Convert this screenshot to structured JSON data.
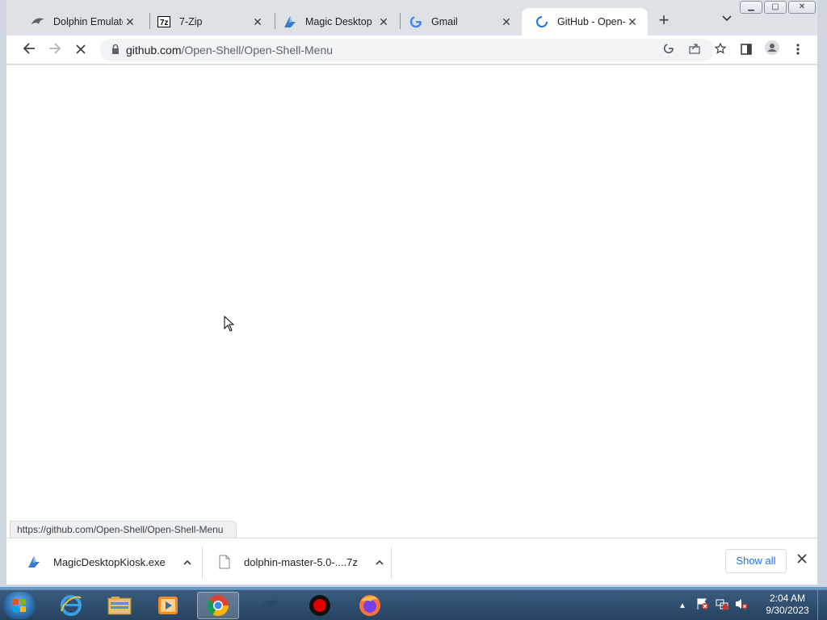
{
  "browser": {
    "tabs": [
      {
        "title": "Dolphin Emulator",
        "icon": "dolphin-icon"
      },
      {
        "title": "7-Zip",
        "icon": "7zip-icon"
      },
      {
        "title": "Magic Desktop",
        "icon": "magic-desktop-icon"
      },
      {
        "title": "Gmail",
        "icon": "google-icon"
      },
      {
        "title": "GitHub - Open-S",
        "icon": "loading-spinner-icon",
        "active": true
      }
    ],
    "new_tab_label": "+",
    "tab_search_label": "⌄",
    "address": {
      "host": "github.com",
      "path": "/Open-Shell/Open-Shell-Menu"
    },
    "status_url": "https://github.com/Open-Shell/Open-Shell-Menu"
  },
  "downloads": {
    "items": [
      {
        "name": "MagicDesktopKiosk.exe",
        "icon": "magic-desktop-icon"
      },
      {
        "name": "dolphin-master-5.0-....7z",
        "icon": "file-icon"
      }
    ],
    "show_all_label": "Show all"
  },
  "taskbar": {
    "apps": [
      "internet-explorer-icon",
      "file-explorer-icon",
      "media-player-icon",
      "chrome-icon",
      "dolphin-app-icon",
      "record-icon",
      "firefox-icon"
    ],
    "clock": {
      "time": "2:04 AM",
      "date": "9/30/2023"
    }
  },
  "colors": {
    "accent": "#1a73e8",
    "tab_bg": "#dee1e6",
    "taskbar": "#2f4f70"
  }
}
